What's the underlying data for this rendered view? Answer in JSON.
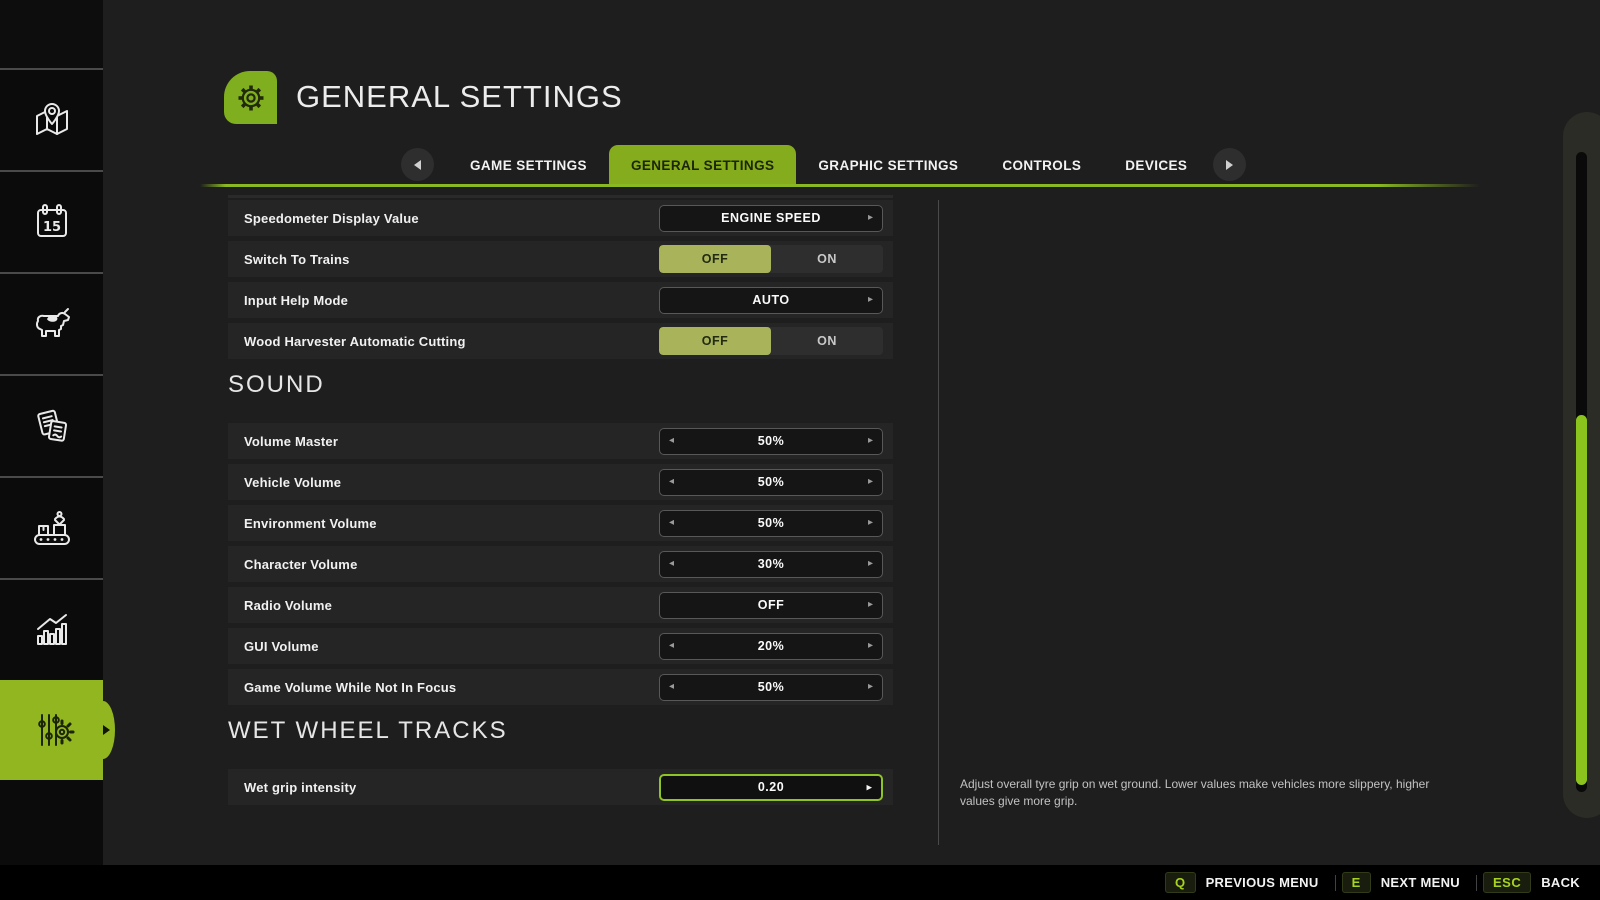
{
  "header": {
    "title": "GENERAL SETTINGS",
    "icon": "gear-icon"
  },
  "tabs": {
    "items": [
      {
        "label": "GAME SETTINGS",
        "active": false
      },
      {
        "label": "GENERAL SETTINGS",
        "active": true
      },
      {
        "label": "GRAPHIC SETTINGS",
        "active": false
      },
      {
        "label": "CONTROLS",
        "active": false
      },
      {
        "label": "DEVICES",
        "active": false
      }
    ]
  },
  "sidebar": {
    "items": [
      {
        "icon": "map",
        "active": false
      },
      {
        "icon": "calendar",
        "active": false
      },
      {
        "icon": "animals",
        "active": false
      },
      {
        "icon": "contracts",
        "active": false
      },
      {
        "icon": "production",
        "active": false
      },
      {
        "icon": "statistics",
        "active": false
      },
      {
        "icon": "settings",
        "active": true
      }
    ]
  },
  "settings": {
    "sections": [
      {
        "title": "",
        "rows": [
          {
            "label": "Speedometer Display Value",
            "control": "stepper",
            "value": "ENGINE SPEED",
            "left_arrow": false,
            "right_arrow": true,
            "focused": false
          },
          {
            "label": "Switch To Trains",
            "control": "toggle",
            "options": [
              "OFF",
              "ON"
            ],
            "value": "OFF"
          },
          {
            "label": "Input Help Mode",
            "control": "stepper",
            "value": "AUTO",
            "left_arrow": false,
            "right_arrow": true,
            "focused": false
          },
          {
            "label": "Wood Harvester Automatic Cutting",
            "control": "toggle",
            "options": [
              "OFF",
              "ON"
            ],
            "value": "OFF"
          }
        ]
      },
      {
        "title": "SOUND",
        "rows": [
          {
            "label": "Volume Master",
            "control": "stepper",
            "value": "50%",
            "left_arrow": true,
            "right_arrow": true,
            "focused": false
          },
          {
            "label": "Vehicle Volume",
            "control": "stepper",
            "value": "50%",
            "left_arrow": true,
            "right_arrow": true,
            "focused": false
          },
          {
            "label": "Environment Volume",
            "control": "stepper",
            "value": "50%",
            "left_arrow": true,
            "right_arrow": true,
            "focused": false
          },
          {
            "label": "Character Volume",
            "control": "stepper",
            "value": "30%",
            "left_arrow": true,
            "right_arrow": true,
            "focused": false
          },
          {
            "label": "Radio Volume",
            "control": "stepper",
            "value": "OFF",
            "left_arrow": false,
            "right_arrow": true,
            "focused": false
          },
          {
            "label": "GUI Volume",
            "control": "stepper",
            "value": "20%",
            "left_arrow": true,
            "right_arrow": true,
            "focused": false
          },
          {
            "label": "Game Volume While Not In Focus",
            "control": "stepper",
            "value": "50%",
            "left_arrow": true,
            "right_arrow": true,
            "focused": false
          }
        ]
      },
      {
        "title": "WET WHEEL TRACKS",
        "rows": [
          {
            "label": "Wet grip intensity",
            "control": "stepper",
            "value": "0.20",
            "left_arrow": false,
            "right_arrow": true,
            "focused": true
          }
        ]
      }
    ]
  },
  "description": {
    "text": "Adjust overall tyre grip on wet ground. Lower values make vehicles more slippery, higher values give more grip."
  },
  "footer": {
    "hints": [
      {
        "key": "Q",
        "label": "PREVIOUS MENU"
      },
      {
        "key": "E",
        "label": "NEXT MENU"
      },
      {
        "key": "ESC",
        "label": "BACK"
      }
    ]
  },
  "glyphs": {
    "arrow_left": "◂",
    "arrow_right": "▸"
  },
  "colors": {
    "accent_tab": "#85ac1d",
    "accent_sidebar": "#92b620",
    "toggle_active": "#a9b45a",
    "scroll_thumb": "#8cc41e",
    "underline": "#8ab822"
  }
}
